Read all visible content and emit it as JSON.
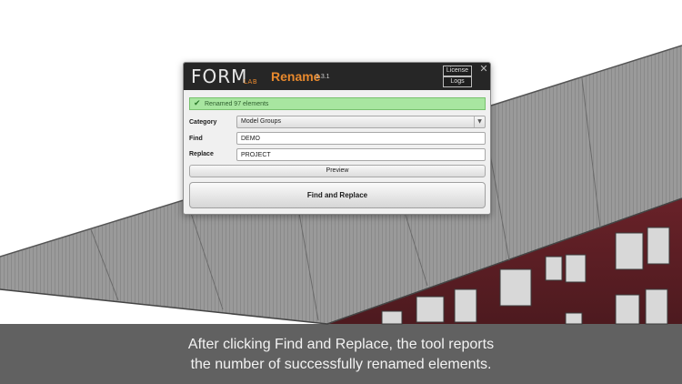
{
  "dialog": {
    "logo_text": "FORM",
    "logo_sub": "LAB",
    "app_name": "Rename",
    "version": "1.3.1",
    "license_label": "License",
    "logs_label": "Logs",
    "close_glyph": "✕",
    "status": {
      "icon": "check-icon",
      "glyph": "✔",
      "text": "Renamed 97 elements",
      "color": "#a8e6a0"
    },
    "category": {
      "label": "Category",
      "value": "Model Groups",
      "chevron": "▼"
    },
    "find": {
      "label": "Find",
      "value": "DEMO"
    },
    "replace": {
      "label": "Replace",
      "value": "PROJECT"
    },
    "preview_label": "Preview",
    "action_label": "Find and Replace"
  },
  "caption": {
    "line1": "After clicking Find and Replace, the tool reports",
    "line2": "the number of successfully renamed elements."
  },
  "colors": {
    "accent": "#e8892d",
    "header_bg": "#262626",
    "roof": "#8f8f8f",
    "brick": "#5a1f24"
  }
}
